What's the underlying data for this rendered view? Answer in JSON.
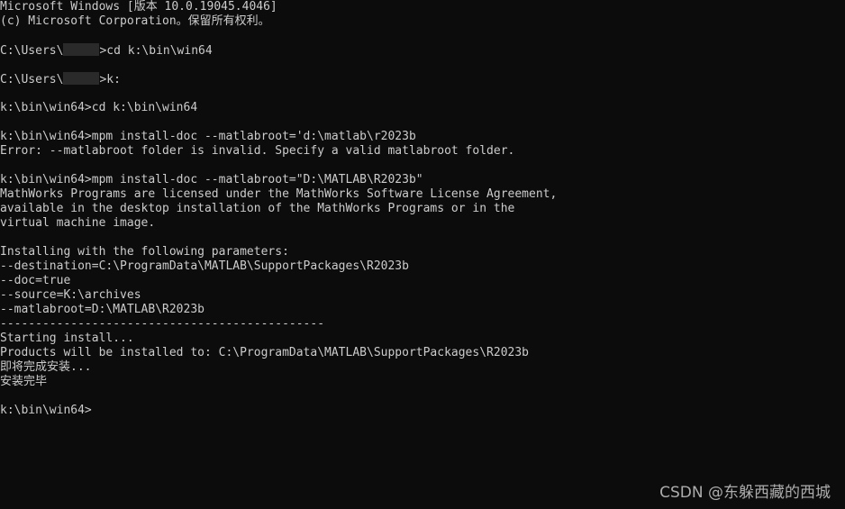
{
  "console": {
    "lines": [
      "Microsoft Windows [版本 10.0.19045.4046]",
      "(c) Microsoft Corporation。保留所有权利。",
      "",
      "C:\\Users\\",
      "",
      "C:\\Users\\",
      "",
      "k:\\bin\\win64>cd k:\\bin\\win64",
      "",
      "k:\\bin\\win64>mpm install-doc --matlabroot='d:\\matlab\\r2023b",
      "Error: --matlabroot folder is invalid. Specify a valid matlabroot folder.",
      "",
      "k:\\bin\\win64>mpm install-doc --matlabroot=\"D:\\MATLAB\\R2023b\"",
      "MathWorks Programs are licensed under the MathWorks Software License Agreement,",
      "available in the desktop installation of the MathWorks Programs or in the",
      "virtual machine image.",
      "",
      "Installing with the following parameters:",
      "--destination=C:\\ProgramData\\MATLAB\\SupportPackages\\R2023b",
      "--doc=true",
      "--source=K:\\archives",
      "--matlabroot=D:\\MATLAB\\R2023b",
      "----------------------------------------------",
      "Starting install...",
      "Products will be installed to: C:\\ProgramData\\MATLAB\\SupportPackages\\R2023b",
      "即将完成安装...",
      "安装完毕",
      ""
    ],
    "masked_line_1_suffix": ">cd k:\\bin\\win64",
    "masked_line_2_suffix": ">k:",
    "prompt": "k:\\bin\\win64>",
    "input_value": ""
  },
  "watermark": {
    "text": "CSDN @东躲西藏的西城"
  },
  "colors": {
    "background": "#0c0c0c",
    "foreground": "#cccccc"
  }
}
